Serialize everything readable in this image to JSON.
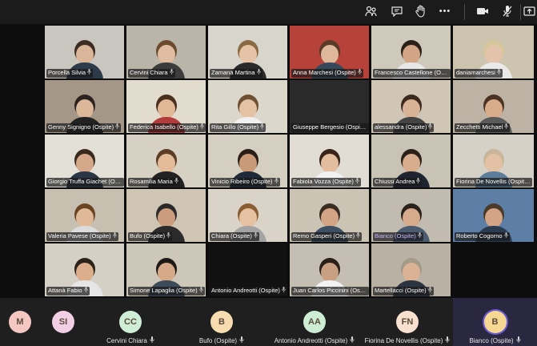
{
  "toolbar": {
    "icons": [
      "participants-icon",
      "chat-icon",
      "raise-hand-icon",
      "more-icon",
      "camera-icon",
      "mic-off-icon",
      "share-icon"
    ],
    "more_label": "•••"
  },
  "mic_glyph": "🎤",
  "tiles": [
    {
      "name": "Porcella Silvia",
      "bg": "#c8c6bf",
      "skin": "#d9b59a",
      "hair": "#3b2b22",
      "shirt": "#2d3a4a"
    },
    {
      "name": "Cervini Chiara",
      "bg": "#b9b5a9",
      "skin": "#e0bda0",
      "hair": "#6b4a2e",
      "shirt": "#3c3c3c"
    },
    {
      "name": "Zamana Martina",
      "bg": "#d8d5cd",
      "skin": "#e5c3a6",
      "hair": "#8a6a42",
      "shirt": "#2a2a2a"
    },
    {
      "name": "Anna Marchesi (Ospite)",
      "bg": "#b7423a",
      "skin": "#dfb89c",
      "hair": "#5a3a28",
      "shirt": "#36485a"
    },
    {
      "name": "Francesco Castellone (Ospite)",
      "bg": "#cfc9bc",
      "skin": "#d2a586",
      "hair": "#2a2018",
      "shirt": "#e8e8e8"
    },
    {
      "name": "daniamarchesi",
      "bg": "#cdc4b0",
      "skin": "#e3c4aa",
      "hair": "#d6c79a",
      "shirt": "#e9e9e9"
    },
    {
      "name": "Genny Signigno (Ospite)",
      "bg": "#a59787",
      "skin": "#ddb79a",
      "hair": "#2c2320",
      "shirt": "#222"
    },
    {
      "name": "Federica Isabello (Ospite)",
      "bg": "#e2dccf",
      "skin": "#e1b896",
      "hair": "#4a2f1f",
      "shirt": "#b23b3b"
    },
    {
      "name": "Rita Gillo (Ospite)",
      "bg": "#dcd7cb",
      "skin": "#e4c2a4",
      "hair": "#6e5032",
      "shirt": "#f0f0f0"
    },
    {
      "name": "Giuseppe Bergesio (Ospite)",
      "bg": "#2a2a2a",
      "skin": "#2a2a2a",
      "hair": "#2a2a2a",
      "shirt": "#2a2a2a"
    },
    {
      "name": "alessandra (Ospite)",
      "bg": "#cfc6b6",
      "skin": "#d9b396",
      "hair": "#3d2a1f",
      "shirt": "#444"
    },
    {
      "name": "Zecchetti Michael",
      "bg": "#bdb3a4",
      "skin": "#d9ad8c",
      "hair": "#4a3322",
      "shirt": "#5a5a5a"
    },
    {
      "name": "Giorgio Truffa Giachet (Ospite)",
      "bg": "#e3e0d8",
      "skin": "#d4a888",
      "hair": "#3a2a1e",
      "shirt": "#2b3644"
    },
    {
      "name": "Rosamilia Maria",
      "bg": "#d7d1c4",
      "skin": "#e4bb98",
      "hair": "#5b3c24",
      "shirt": "#222"
    },
    {
      "name": "Vinicio Ribeiro (Ospite)",
      "bg": "#d5cfc2",
      "skin": "#c99a78",
      "hair": "#2a1f18",
      "shirt": "#1f2a38"
    },
    {
      "name": "Fabiola Vozza (Ospite)",
      "bg": "#e1ddd4",
      "skin": "#e2be9f",
      "hair": "#3a2419",
      "shirt": "#f2f2f2"
    },
    {
      "name": "Chiussi Andrea",
      "bg": "#c9c3b5",
      "skin": "#d8ad8d",
      "hair": "#2b211a",
      "shirt": "#1e2530"
    },
    {
      "name": "Fiorina De Novellis (Ospite)",
      "bg": "#d6d1c6",
      "skin": "#e3c1a4",
      "hair": "#c9b69a",
      "shirt": "#5d7d9a"
    },
    {
      "name": "Valeria Pavese (Ospite)",
      "bg": "#c7bfb0",
      "skin": "#e0b999",
      "hair": "#6b4424",
      "shirt": "#dcdcdc"
    },
    {
      "name": "Bufo (Ospite)",
      "bg": "#cfc5b4",
      "skin": "#c99d7e",
      "hair": "#2a2a2a",
      "shirt": "#2b2b2b"
    },
    {
      "name": "Chiara (Ospite)",
      "bg": "#dad4c8",
      "skin": "#e6c2a2",
      "hair": "#8a5d33",
      "shirt": "#a3a3a3"
    },
    {
      "name": "Remo Gasperi (Ospite)",
      "bg": "#cbc3b3",
      "skin": "#d3a584",
      "hair": "#3a2c22",
      "shirt": "#3e4f63"
    },
    {
      "name": "Bianco (Ospite)",
      "bg": "#c2bcb0",
      "skin": "#d6ab8c",
      "hair": "#2a231d",
      "shirt": "#4b5c70",
      "hl": true
    },
    {
      "name": "Roberto Cogorno",
      "bg": "#5d7fa5",
      "skin": "#d3a586",
      "hair": "#4a3a2a",
      "shirt": "#2b3b50"
    },
    {
      "name": "Attanà Fabio",
      "bg": "#d4d0c5",
      "skin": "#dcae8c",
      "hair": "#2b221a",
      "shirt": "#e6e6e6"
    },
    {
      "name": "Simone Lapaglia (Ospite)",
      "bg": "#cdc7ba",
      "skin": "#d6a988",
      "hair": "#1f1915",
      "shirt": "#3c4a5a"
    },
    {
      "name": "Antonio Andreotti (Ospite)",
      "bg": "#111111",
      "skin": "#111111",
      "hair": "#111111",
      "shirt": "#111111"
    },
    {
      "name": "Juan Carlos Piccinini (Ospite)",
      "bg": "#c5bfb3",
      "skin": "#caa082",
      "hair": "#2b2017",
      "shirt": "#f2f2f2"
    },
    {
      "name": "Martellacci (Ospite)",
      "bg": "#b9b2a4",
      "skin": "#dcb294",
      "hair": "#a49a8a",
      "shirt": "#2c3440"
    }
  ],
  "bottom": [
    {
      "initials": "M",
      "name": "",
      "color": "#f4c7c3"
    },
    {
      "initials": "SI",
      "name": "",
      "color": "#f2cfe4"
    },
    {
      "initials": "CC",
      "name": "Cervini Chiara",
      "color": "#cfeed6"
    },
    {
      "initials": "B",
      "name": "Bufo (Ospite)",
      "color": "#f7dcb0"
    },
    {
      "initials": "AA",
      "name": "Antonio Andreotti (Ospite)",
      "color": "#cdeed4"
    },
    {
      "initials": "FN",
      "name": "Fiorina De Novellis (Ospite)",
      "color": "#f9e0cf"
    },
    {
      "initials": "B",
      "name": "Bianco (Ospite)",
      "color": "#f7d893",
      "ring": "#6b5bd1"
    }
  ]
}
